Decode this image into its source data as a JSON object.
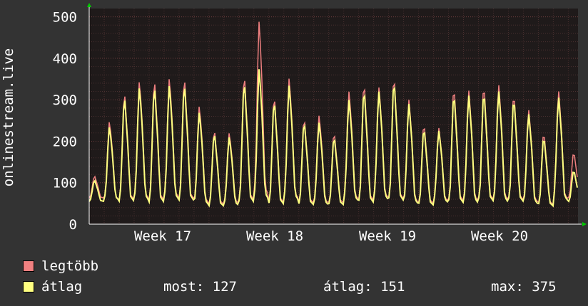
{
  "chart_data": {
    "type": "line",
    "ylabel": "onlinestream.live",
    "ylim": [
      0,
      520
    ],
    "yticks": [
      0,
      100,
      200,
      300,
      400,
      500
    ],
    "xticks": [
      "Week 17",
      "Week 18",
      "Week 19",
      "Week 20"
    ],
    "grid": true,
    "legend_placement": "bottom",
    "series": [
      {
        "name": "legtöbb",
        "color": "#f08080",
        "daily_peaks": [
          115,
          248,
          310,
          345,
          340,
          352,
          345,
          285,
          222,
          220,
          350,
          490,
          300,
          352,
          248,
          262,
          215,
          320,
          330,
          330,
          345,
          300,
          235,
          232,
          320,
          322,
          325,
          335,
          305,
          275,
          215,
          320,
          170
        ],
        "daily_troughs": [
          60,
          48,
          45,
          45,
          42,
          48,
          45,
          38,
          38,
          40,
          42,
          45,
          38,
          45,
          40,
          38,
          42,
          45,
          42,
          48,
          45,
          38,
          40,
          45,
          42,
          40,
          45,
          42,
          45,
          40,
          38,
          45,
          55
        ]
      },
      {
        "name": "átlag",
        "color": "#ffff80",
        "daily_peaks": [
          105,
          235,
          300,
          330,
          325,
          335,
          330,
          270,
          215,
          210,
          335,
          375,
          290,
          335,
          240,
          245,
          205,
          300,
          315,
          320,
          335,
          290,
          225,
          225,
          305,
          310,
          310,
          320,
          295,
          265,
          205,
          305,
          127
        ],
        "daily_troughs": [
          52,
          48,
          42,
          42,
          38,
          44,
          42,
          34,
          34,
          36,
          38,
          42,
          35,
          42,
          36,
          35,
          38,
          42,
          38,
          44,
          42,
          35,
          36,
          42,
          38,
          36,
          42,
          38,
          42,
          36,
          35,
          42,
          48
        ],
        "stats": {
          "most": 127,
          "atlag": 151,
          "max": 375
        }
      }
    ]
  },
  "legend": {
    "max_label": "legtöbb",
    "avg_label": "átlag",
    "most_text": "most: 127",
    "atlag_text": "átlag: 151",
    "max_text": "max: 375"
  }
}
